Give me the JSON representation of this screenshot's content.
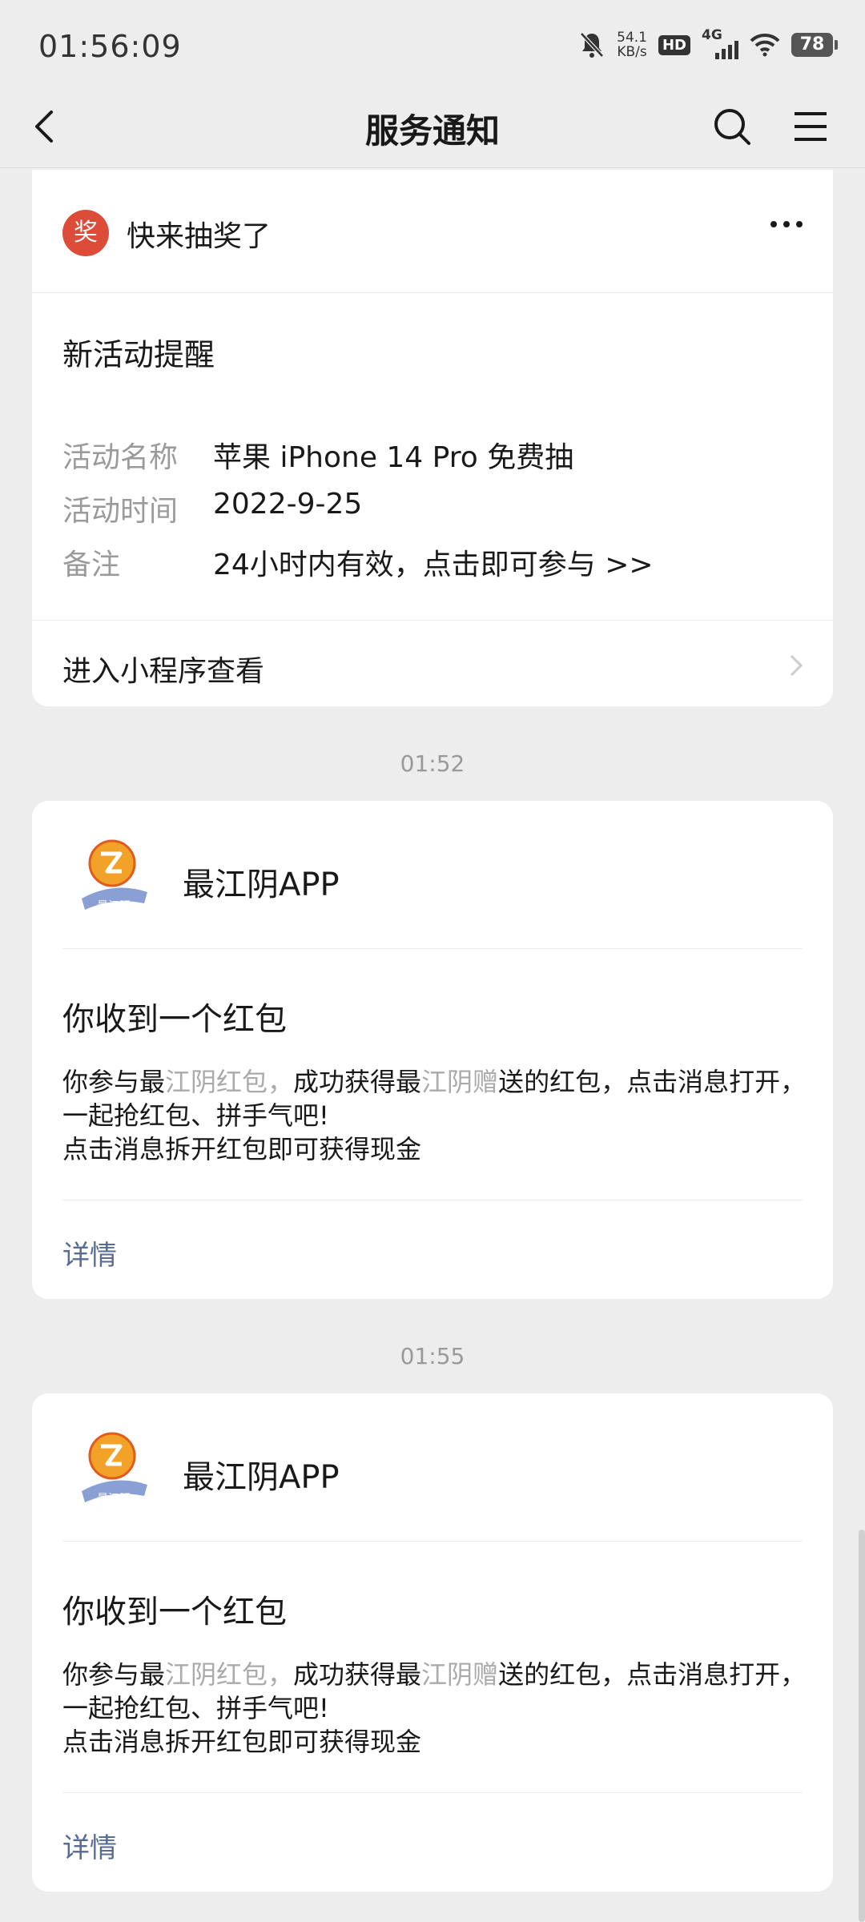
{
  "status_bar": {
    "time": "01:56:09",
    "net_speed_value": "54.1",
    "net_speed_unit": "KB/s",
    "hd": "HD",
    "network": "4G",
    "battery": "78"
  },
  "nav": {
    "title": "服务通知"
  },
  "card1": {
    "badge": "奖",
    "sender": "快来抽奖了",
    "subtitle": "新活动提醒",
    "fields": [
      {
        "key": "活动名称",
        "value": "苹果 iPhone 14 Pro 免费抽"
      },
      {
        "key": "活动时间",
        "value": "2022-9-25"
      },
      {
        "key": "备注",
        "value": "24小时内有效，点击即可参与 >>"
      }
    ],
    "footer": "进入小程序查看"
  },
  "messages": [
    {
      "time": "01:52",
      "app_name": "最江阴APP",
      "logo_text": "最江阴",
      "title": "你收到一个红包",
      "body_a": "你参与最",
      "body_b": "江阴红包，",
      "body_c": "成功获得最",
      "body_d": "江阴赠",
      "body_e": "送的红包，点击消息打开，一起抢红包、拼手气吧!",
      "body_line2": "点击消息拆开红包即可获得现金",
      "detail": "详情"
    },
    {
      "time": "01:55",
      "app_name": "最江阴APP",
      "logo_text": "最江阴",
      "title": "你收到一个红包",
      "body_a": "你参与最",
      "body_b": "江阴红包，",
      "body_c": "成功获得最",
      "body_d": "江阴赠",
      "body_e": "送的红包，点击消息打开，一起抢红包、拼手气吧!",
      "body_line2": "点击消息拆开红包即可获得现金",
      "detail": "详情"
    }
  ],
  "icons": [
    "back-icon",
    "search-icon",
    "menu-icon",
    "more-icon",
    "chevron-right-icon",
    "mute-bell-icon",
    "wifi-icon"
  ],
  "colors": {
    "link": "#576b95",
    "badge": "#dd4b39",
    "background": "#ededed"
  }
}
